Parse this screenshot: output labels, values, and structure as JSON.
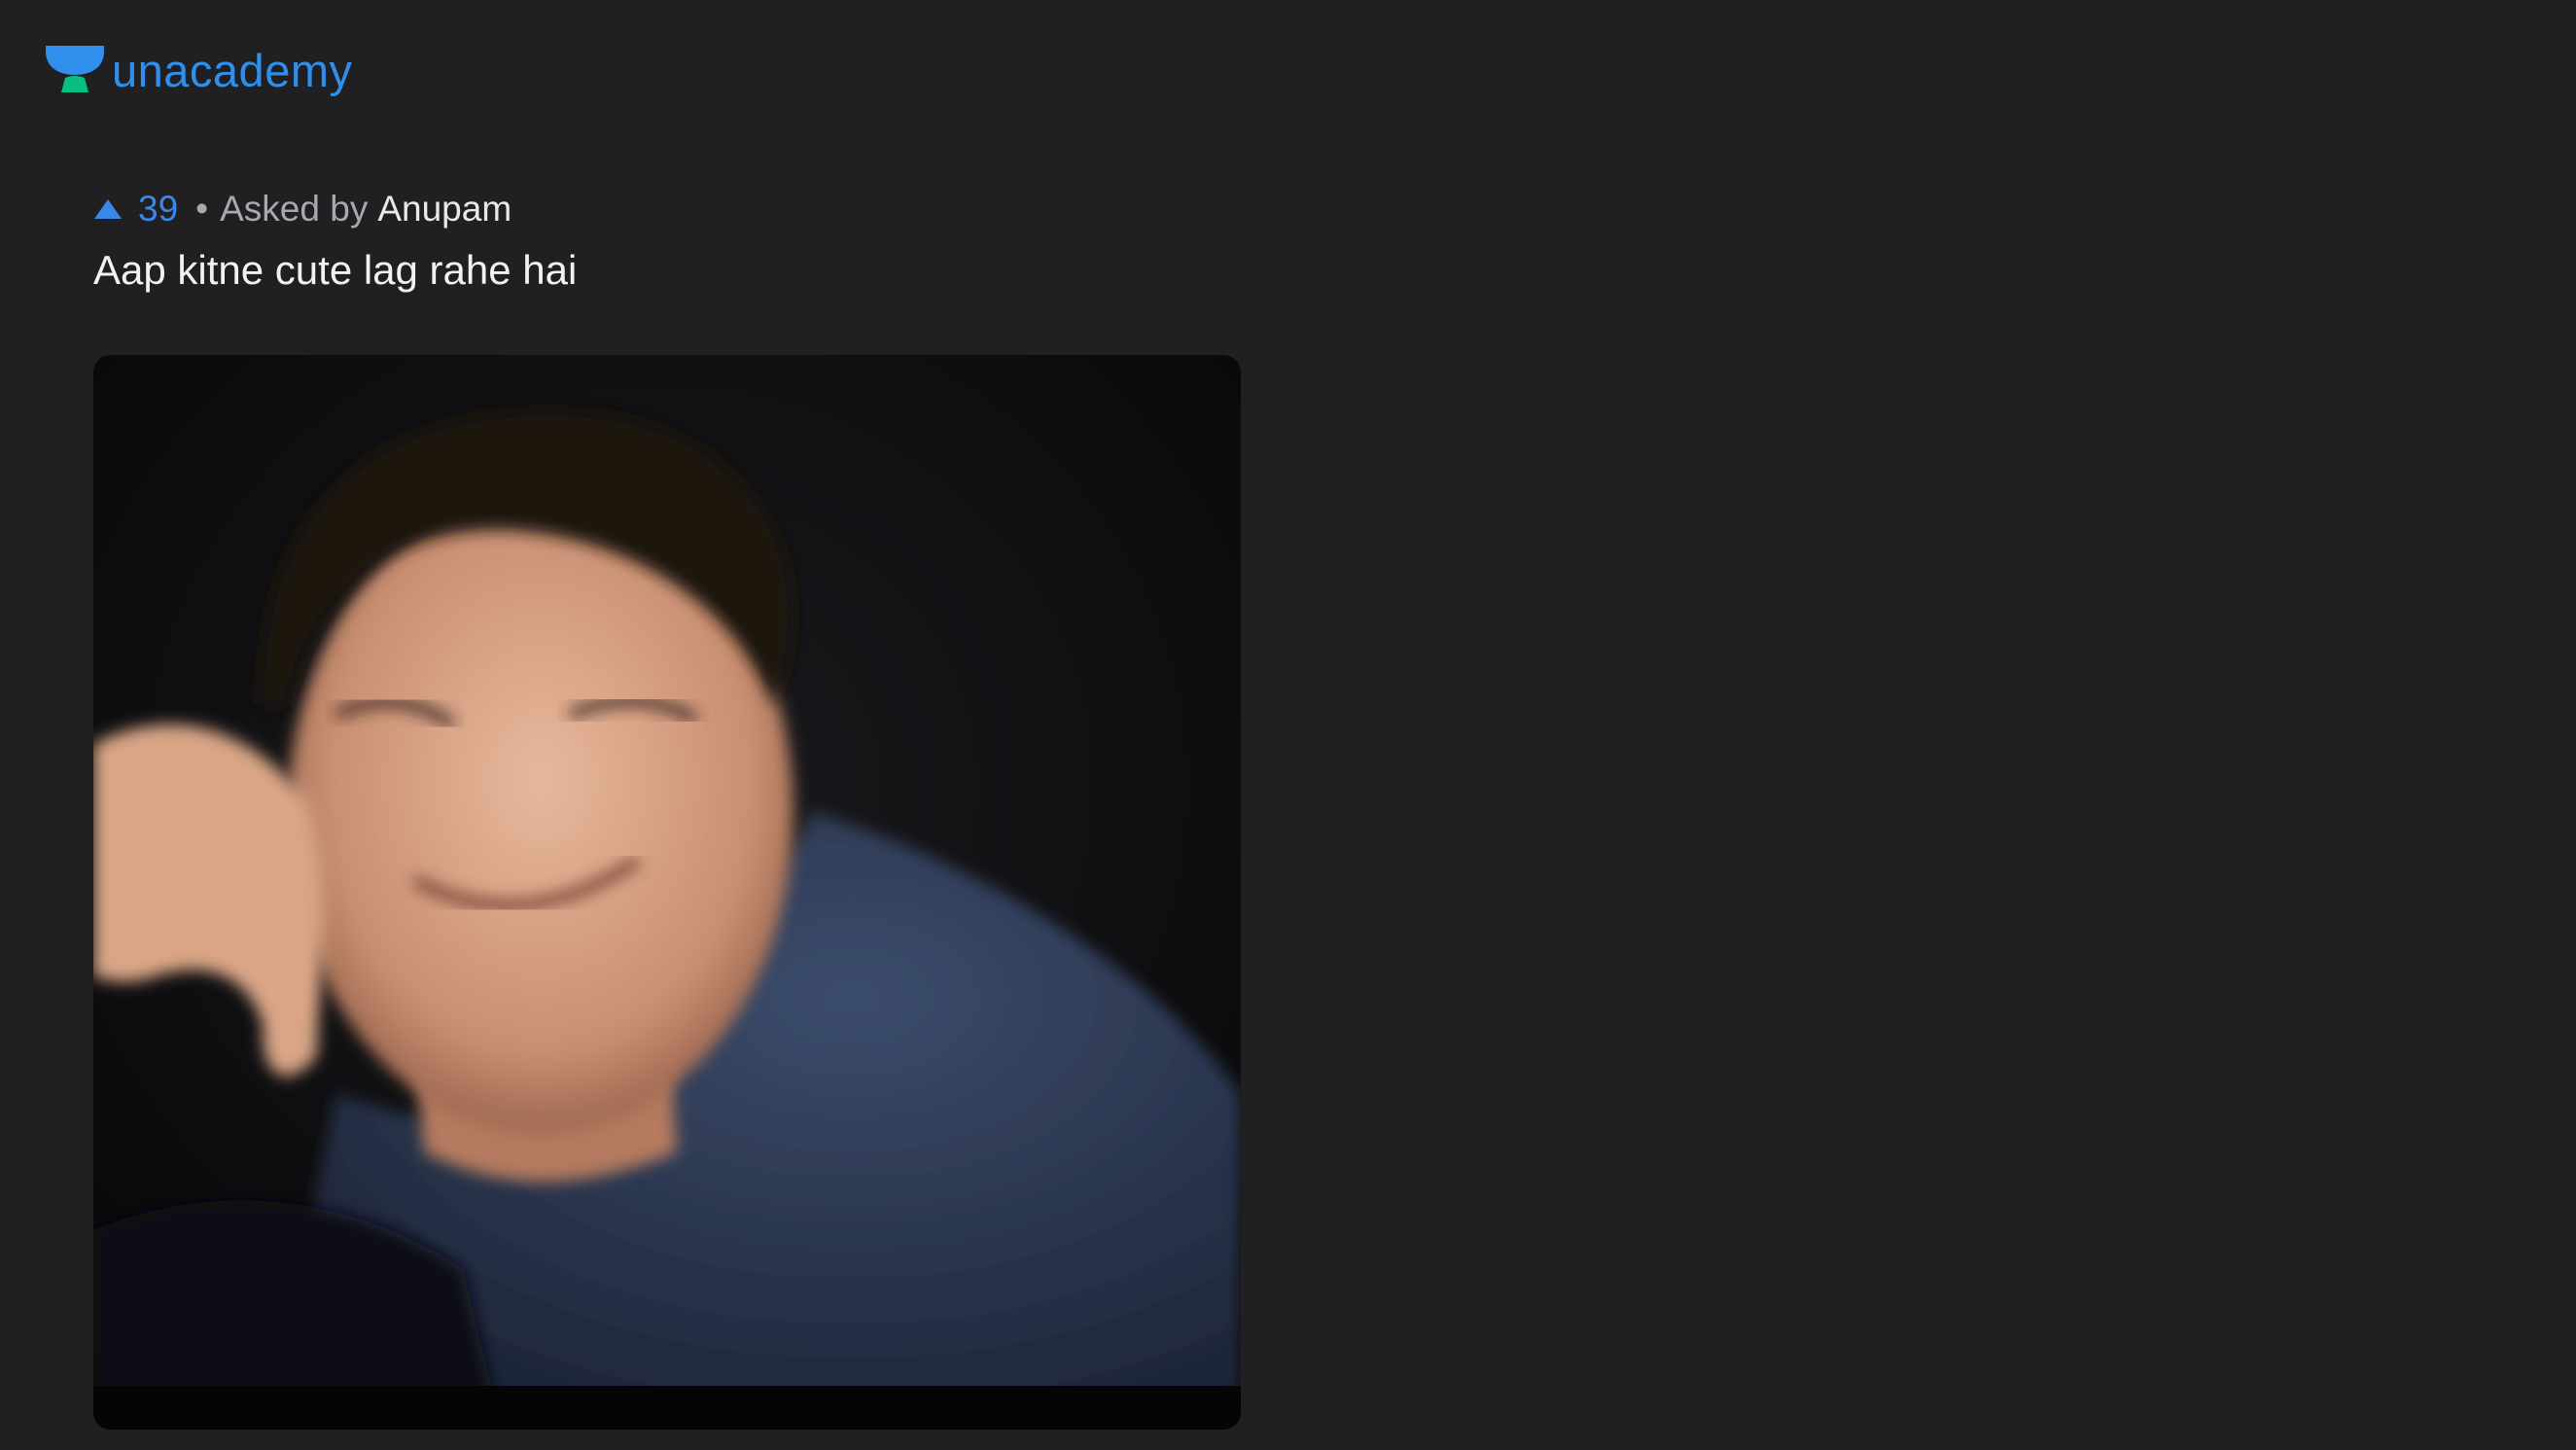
{
  "brand": {
    "name": "unacademy",
    "color": "#2f8fea",
    "accent_color": "#08bd80"
  },
  "question": {
    "upvotes": "39",
    "separator": "•",
    "asked_by_label": "Asked by",
    "author": "Anupam",
    "text": "Aap kitne cute lag rahe hai"
  },
  "video": {
    "icon": "webcam-video-feed"
  },
  "colors": {
    "background": "#202022",
    "upvote": "#3a87e8"
  }
}
